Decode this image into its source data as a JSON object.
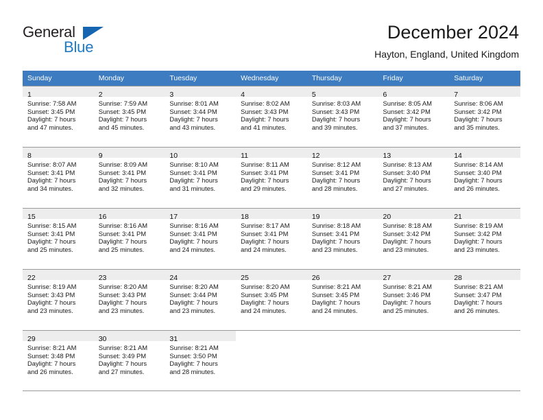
{
  "brand": {
    "name_top": "General",
    "name_bottom": "Blue",
    "triangle_icon": "triangle-icon",
    "color_dark": "#231f20",
    "color_blue": "#1f7ac4"
  },
  "header": {
    "title": "December 2024",
    "subtitle": "Hayton, England, United Kingdom"
  },
  "calendar": {
    "header_background": "#3d7cc0",
    "daynum_background": "#ededed",
    "weekday_headers": [
      "Sunday",
      "Monday",
      "Tuesday",
      "Wednesday",
      "Thursday",
      "Friday",
      "Saturday"
    ],
    "weeks": [
      [
        {
          "day": "1",
          "sunrise": "Sunrise: 7:58 AM",
          "sunset": "Sunset: 3:45 PM",
          "daylight_line1": "Daylight: 7 hours",
          "daylight_line2": "and 47 minutes."
        },
        {
          "day": "2",
          "sunrise": "Sunrise: 7:59 AM",
          "sunset": "Sunset: 3:45 PM",
          "daylight_line1": "Daylight: 7 hours",
          "daylight_line2": "and 45 minutes."
        },
        {
          "day": "3",
          "sunrise": "Sunrise: 8:01 AM",
          "sunset": "Sunset: 3:44 PM",
          "daylight_line1": "Daylight: 7 hours",
          "daylight_line2": "and 43 minutes."
        },
        {
          "day": "4",
          "sunrise": "Sunrise: 8:02 AM",
          "sunset": "Sunset: 3:43 PM",
          "daylight_line1": "Daylight: 7 hours",
          "daylight_line2": "and 41 minutes."
        },
        {
          "day": "5",
          "sunrise": "Sunrise: 8:03 AM",
          "sunset": "Sunset: 3:43 PM",
          "daylight_line1": "Daylight: 7 hours",
          "daylight_line2": "and 39 minutes."
        },
        {
          "day": "6",
          "sunrise": "Sunrise: 8:05 AM",
          "sunset": "Sunset: 3:42 PM",
          "daylight_line1": "Daylight: 7 hours",
          "daylight_line2": "and 37 minutes."
        },
        {
          "day": "7",
          "sunrise": "Sunrise: 8:06 AM",
          "sunset": "Sunset: 3:42 PM",
          "daylight_line1": "Daylight: 7 hours",
          "daylight_line2": "and 35 minutes."
        }
      ],
      [
        {
          "day": "8",
          "sunrise": "Sunrise: 8:07 AM",
          "sunset": "Sunset: 3:41 PM",
          "daylight_line1": "Daylight: 7 hours",
          "daylight_line2": "and 34 minutes."
        },
        {
          "day": "9",
          "sunrise": "Sunrise: 8:09 AM",
          "sunset": "Sunset: 3:41 PM",
          "daylight_line1": "Daylight: 7 hours",
          "daylight_line2": "and 32 minutes."
        },
        {
          "day": "10",
          "sunrise": "Sunrise: 8:10 AM",
          "sunset": "Sunset: 3:41 PM",
          "daylight_line1": "Daylight: 7 hours",
          "daylight_line2": "and 31 minutes."
        },
        {
          "day": "11",
          "sunrise": "Sunrise: 8:11 AM",
          "sunset": "Sunset: 3:41 PM",
          "daylight_line1": "Daylight: 7 hours",
          "daylight_line2": "and 29 minutes."
        },
        {
          "day": "12",
          "sunrise": "Sunrise: 8:12 AM",
          "sunset": "Sunset: 3:41 PM",
          "daylight_line1": "Daylight: 7 hours",
          "daylight_line2": "and 28 minutes."
        },
        {
          "day": "13",
          "sunrise": "Sunrise: 8:13 AM",
          "sunset": "Sunset: 3:40 PM",
          "daylight_line1": "Daylight: 7 hours",
          "daylight_line2": "and 27 minutes."
        },
        {
          "day": "14",
          "sunrise": "Sunrise: 8:14 AM",
          "sunset": "Sunset: 3:40 PM",
          "daylight_line1": "Daylight: 7 hours",
          "daylight_line2": "and 26 minutes."
        }
      ],
      [
        {
          "day": "15",
          "sunrise": "Sunrise: 8:15 AM",
          "sunset": "Sunset: 3:41 PM",
          "daylight_line1": "Daylight: 7 hours",
          "daylight_line2": "and 25 minutes."
        },
        {
          "day": "16",
          "sunrise": "Sunrise: 8:16 AM",
          "sunset": "Sunset: 3:41 PM",
          "daylight_line1": "Daylight: 7 hours",
          "daylight_line2": "and 25 minutes."
        },
        {
          "day": "17",
          "sunrise": "Sunrise: 8:16 AM",
          "sunset": "Sunset: 3:41 PM",
          "daylight_line1": "Daylight: 7 hours",
          "daylight_line2": "and 24 minutes."
        },
        {
          "day": "18",
          "sunrise": "Sunrise: 8:17 AM",
          "sunset": "Sunset: 3:41 PM",
          "daylight_line1": "Daylight: 7 hours",
          "daylight_line2": "and 24 minutes."
        },
        {
          "day": "19",
          "sunrise": "Sunrise: 8:18 AM",
          "sunset": "Sunset: 3:41 PM",
          "daylight_line1": "Daylight: 7 hours",
          "daylight_line2": "and 23 minutes."
        },
        {
          "day": "20",
          "sunrise": "Sunrise: 8:18 AM",
          "sunset": "Sunset: 3:42 PM",
          "daylight_line1": "Daylight: 7 hours",
          "daylight_line2": "and 23 minutes."
        },
        {
          "day": "21",
          "sunrise": "Sunrise: 8:19 AM",
          "sunset": "Sunset: 3:42 PM",
          "daylight_line1": "Daylight: 7 hours",
          "daylight_line2": "and 23 minutes."
        }
      ],
      [
        {
          "day": "22",
          "sunrise": "Sunrise: 8:19 AM",
          "sunset": "Sunset: 3:43 PM",
          "daylight_line1": "Daylight: 7 hours",
          "daylight_line2": "and 23 minutes."
        },
        {
          "day": "23",
          "sunrise": "Sunrise: 8:20 AM",
          "sunset": "Sunset: 3:43 PM",
          "daylight_line1": "Daylight: 7 hours",
          "daylight_line2": "and 23 minutes."
        },
        {
          "day": "24",
          "sunrise": "Sunrise: 8:20 AM",
          "sunset": "Sunset: 3:44 PM",
          "daylight_line1": "Daylight: 7 hours",
          "daylight_line2": "and 23 minutes."
        },
        {
          "day": "25",
          "sunrise": "Sunrise: 8:20 AM",
          "sunset": "Sunset: 3:45 PM",
          "daylight_line1": "Daylight: 7 hours",
          "daylight_line2": "and 24 minutes."
        },
        {
          "day": "26",
          "sunrise": "Sunrise: 8:21 AM",
          "sunset": "Sunset: 3:45 PM",
          "daylight_line1": "Daylight: 7 hours",
          "daylight_line2": "and 24 minutes."
        },
        {
          "day": "27",
          "sunrise": "Sunrise: 8:21 AM",
          "sunset": "Sunset: 3:46 PM",
          "daylight_line1": "Daylight: 7 hours",
          "daylight_line2": "and 25 minutes."
        },
        {
          "day": "28",
          "sunrise": "Sunrise: 8:21 AM",
          "sunset": "Sunset: 3:47 PM",
          "daylight_line1": "Daylight: 7 hours",
          "daylight_line2": "and 26 minutes."
        }
      ],
      [
        {
          "day": "29",
          "sunrise": "Sunrise: 8:21 AM",
          "sunset": "Sunset: 3:48 PM",
          "daylight_line1": "Daylight: 7 hours",
          "daylight_line2": "and 26 minutes."
        },
        {
          "day": "30",
          "sunrise": "Sunrise: 8:21 AM",
          "sunset": "Sunset: 3:49 PM",
          "daylight_line1": "Daylight: 7 hours",
          "daylight_line2": "and 27 minutes."
        },
        {
          "day": "31",
          "sunrise": "Sunrise: 8:21 AM",
          "sunset": "Sunset: 3:50 PM",
          "daylight_line1": "Daylight: 7 hours",
          "daylight_line2": "and 28 minutes."
        },
        {
          "day": "",
          "sunrise": "",
          "sunset": "",
          "daylight_line1": "",
          "daylight_line2": ""
        },
        {
          "day": "",
          "sunrise": "",
          "sunset": "",
          "daylight_line1": "",
          "daylight_line2": ""
        },
        {
          "day": "",
          "sunrise": "",
          "sunset": "",
          "daylight_line1": "",
          "daylight_line2": ""
        },
        {
          "day": "",
          "sunrise": "",
          "sunset": "",
          "daylight_line1": "",
          "daylight_line2": ""
        }
      ]
    ]
  }
}
